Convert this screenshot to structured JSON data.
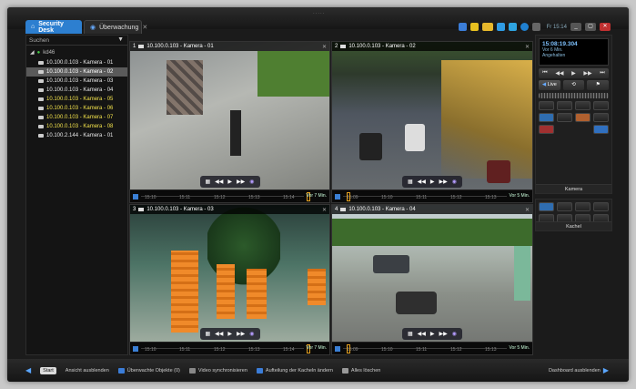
{
  "topbar": {
    "tabs": [
      {
        "label": "Security Desk",
        "active": true
      },
      {
        "label": "Überwachung",
        "active": false
      }
    ],
    "clock": "Fr 15:14",
    "handle": "....."
  },
  "sidebar": {
    "search_placeholder": "Suchen",
    "root": "kd46",
    "cameras": [
      {
        "label": "10.100.0.103 - Kamera - 01",
        "state": "normal"
      },
      {
        "label": "10.100.0.103 - Kamera - 02",
        "state": "selected"
      },
      {
        "label": "10.100.0.103 - Kamera - 03",
        "state": "normal"
      },
      {
        "label": "10.100.0.103 - Kamera - 04",
        "state": "normal"
      },
      {
        "label": "10.100.0.103 - Kamera - 05",
        "state": "yellow"
      },
      {
        "label": "10.100.0.103 - Kamera - 06",
        "state": "yellow"
      },
      {
        "label": "10.100.0.103 - Kamera - 07",
        "state": "yellow"
      },
      {
        "label": "10.100.0.103 - Kamera - 08",
        "state": "yellow"
      },
      {
        "label": "10.100.2.144 - Kamera - 01",
        "state": "normal"
      }
    ]
  },
  "tiles": [
    {
      "num": "1",
      "title": "10.100.0.103 - Kamera - 01",
      "range": "Vor 7 Min.",
      "marks": [
        "15:10",
        "15:11",
        "15:12",
        "15:13",
        "15:14"
      ]
    },
    {
      "num": "2",
      "title": "10.100.0.103 - Kamera - 02",
      "range": "Vor 5 Min.",
      "marks": [
        "15:09",
        "15:10",
        "15:11",
        "15:12",
        "15:13"
      ]
    },
    {
      "num": "3",
      "title": "10.100.0.103 - Kamera - 03",
      "range": "Vor 7 Min.",
      "marks": [
        "15:10",
        "15:11",
        "15:12",
        "15:13",
        "15:14"
      ]
    },
    {
      "num": "4",
      "title": "10.100.0.103 - Kamera - 04",
      "range": "Vor 5 Min.",
      "marks": [
        "15:09",
        "15:10",
        "15:11",
        "15:12",
        "15:13"
      ]
    }
  ],
  "panel": {
    "time": "15:08:19.304",
    "ago": "Vor 6 Min.",
    "status": "Angehalten",
    "live_label": "Live",
    "camera_footer": "Kamera",
    "tiles_footer": "Kachel"
  },
  "bottombar": {
    "start": "Start",
    "items": [
      "Ansicht ausblenden",
      "Überwachte Objekte (0)",
      "Video synchronisieren",
      "Aufteilung der Kacheln ändern",
      "Alles löschen"
    ],
    "dashboard": "Dashboard ausblenden"
  },
  "colors": {
    "accent": "#2d7fd0",
    "highlight_yellow": "#f2e24b",
    "timeline_marker": "#e3a020"
  }
}
